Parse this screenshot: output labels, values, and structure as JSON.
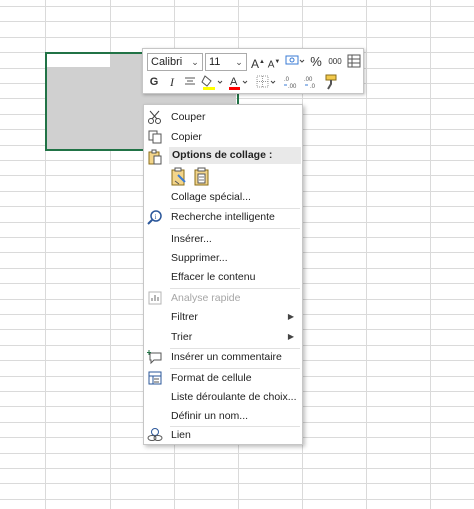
{
  "minibar": {
    "font_name": "Calibri",
    "font_size": "11",
    "grow_label": "A",
    "shrink_label": "A",
    "percent_label": "%",
    "thousands_label": "000",
    "bold_label": "G",
    "italic_label": "I",
    "fill_color": "#ffff00",
    "font_color": "#ff0000"
  },
  "menu": {
    "cut": "Couper",
    "copy": "Copier",
    "paste_options": "Options de collage :",
    "paste_special": "Collage spécial...",
    "smart_lookup": "Recherche intelligente",
    "insert": "Insérer...",
    "delete": "Supprimer...",
    "clear": "Effacer le contenu",
    "quick_analysis": "Analyse rapide",
    "filter": "Filtrer",
    "sort": "Trier",
    "insert_comment": "Insérer un commentaire",
    "format_cells": "Format de cellule",
    "pick_list": "Liste déroulante de choix...",
    "define_name": "Définir un nom...",
    "link": "Lien"
  },
  "colors": {
    "selection_border": "#217346",
    "selection_fill": "#d0d0d0"
  }
}
